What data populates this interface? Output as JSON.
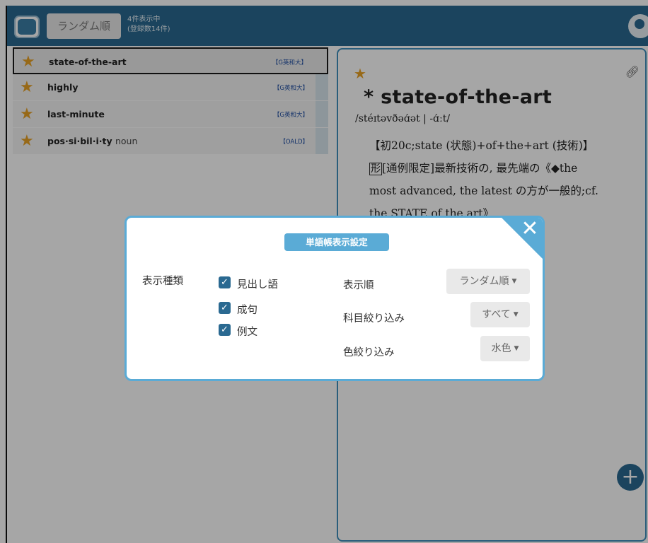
{
  "header": {
    "sort_button": "ランダム順",
    "count_line1": "4件表示中",
    "count_line2": "(登録数14件)"
  },
  "word_list": [
    {
      "word": "state-of-the-art",
      "pos": "",
      "dict": "【G英和大】",
      "starred": true,
      "selected": true
    },
    {
      "word": "highly",
      "pos": "",
      "dict": "【G英和大】",
      "starred": true,
      "selected": false
    },
    {
      "word": "last-minute",
      "pos": "",
      "dict": "【G英和大】",
      "starred": true,
      "selected": false
    },
    {
      "word": "pos·si·bil·i·ty",
      "pos": "noun",
      "dict": "【OALD】",
      "starred": true,
      "selected": false
    }
  ],
  "detail": {
    "headword": "* state‐of‐the‐art",
    "pronunciation": "/stéɪtəvðəɑ́ət | -ɑ́ːt/",
    "etymology": "【初20c;state (状態)+of+the+art (技術)】",
    "pos_mark": "形",
    "definition": "[通例限定]最新技術の, 最先端の《◆the",
    "definition_2": "most advanced, the latest の方が一般的;cf.",
    "definition_3": "the STATE of the art》"
  },
  "modal": {
    "title": "単語帳表示設定",
    "type_label": "表示種類",
    "checks": [
      {
        "label": "見出し語",
        "checked": true
      },
      {
        "label": "成句",
        "checked": true
      },
      {
        "label": "例文",
        "checked": true
      }
    ],
    "settings": [
      {
        "label": "表示順",
        "value": "ランダム順"
      },
      {
        "label": "科目絞り込み",
        "value": "すべて"
      },
      {
        "label": "色絞り込み",
        "value": "水色"
      }
    ]
  },
  "colors": {
    "header": "#2a6991",
    "accent": "#5aabd6",
    "star": "#e9a126"
  },
  "icons": {
    "star": "star-icon",
    "link": "link-icon",
    "close": "close-icon",
    "add": "plus-icon",
    "profile": "user-icon",
    "logo": "app-logo-icon"
  }
}
